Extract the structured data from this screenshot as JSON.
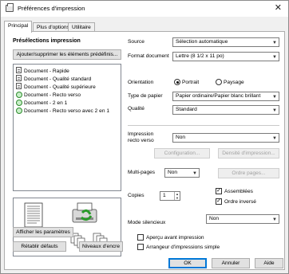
{
  "window": {
    "title": "Préférences d'impression",
    "close_glyph": "✕"
  },
  "tabs": [
    {
      "label": "Principal",
      "active": true
    },
    {
      "label": "Plus d'options",
      "active": false
    },
    {
      "label": "Utilitaire",
      "active": false
    }
  ],
  "presets": {
    "heading": "Présélections impression",
    "add_remove_button": "Ajouter/supprimer les éléments prédéfinis...",
    "items": [
      {
        "label": "Document - Rapide",
        "icon": "document-icon"
      },
      {
        "label": "Document - Qualité standard",
        "icon": "document-icon"
      },
      {
        "label": "Document - Qualité supérieure",
        "icon": "document-icon"
      },
      {
        "label": "Document - Recto verso",
        "icon": "eco-icon"
      },
      {
        "label": "Document - 2 en 1",
        "icon": "eco-icon"
      },
      {
        "label": "Document - Recto verso avec 2 en 1",
        "icon": "eco-icon"
      }
    ]
  },
  "left_buttons": {
    "show_settings": "Afficher les paramètres",
    "restore_defaults": "Rétablir défauts",
    "ink_levels": "Niveaux d'encre"
  },
  "settings": {
    "source_label": "Source",
    "source_value": "Sélection automatique",
    "format_label": "Format document",
    "format_value": "Lettre (8 1/2 x 11 po)",
    "orientation_label": "Orientation",
    "orientation_portrait": "Portrait",
    "orientation_landscape": "Paysage",
    "paper_type_label": "Type de papier",
    "paper_type_value": "Papier ordinaire/Papier blanc brillant",
    "quality_label": "Qualité",
    "quality_value": "Standard",
    "duplex_label_line1": "Impression",
    "duplex_label_line2": "recto verso",
    "duplex_value": "Non",
    "configuration_button": "Configuration...",
    "density_button": "Densité d'impression...",
    "multipage_label": "Multi-pages",
    "multipage_value": "Non",
    "page_order_button": "Ordre pages...",
    "copies_label": "Copies",
    "copies_value": "1",
    "collate_label": "Assemblées",
    "reverse_order_label": "Ordre inversé",
    "quiet_mode_label": "Mode silencieux",
    "quiet_mode_value": "Non",
    "print_preview_label": "Aperçu avant impression",
    "simple_arranger_label": "Arrangeur d'impressions simple"
  },
  "footer": {
    "ok": "OK",
    "cancel": "Annuler",
    "help": "Aide"
  }
}
